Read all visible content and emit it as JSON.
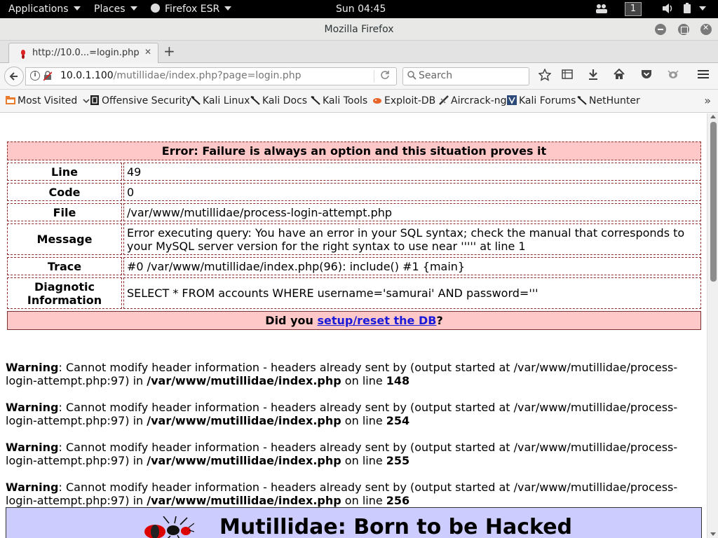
{
  "system_bar": {
    "applications": "Applications",
    "places": "Places",
    "firefox": "Firefox ESR",
    "clock": "Sun 04:45",
    "workspace": "1"
  },
  "window": {
    "title": "Mozilla Firefox"
  },
  "tab": {
    "title": "http://10.0...=login.php",
    "close": "✕",
    "new_tab": "+"
  },
  "navbar": {
    "url_host": "10.0.1.100",
    "url_path": "/mutillidae/index.php?page=login.php",
    "search_placeholder": "Search"
  },
  "bookmarks": {
    "items": [
      {
        "label": "Most Visited",
        "icon": "folder-icon"
      },
      {
        "label": "Offensive Security",
        "icon": "offsec-icon"
      },
      {
        "label": "Kali Linux",
        "icon": "kali-icon"
      },
      {
        "label": "Kali Docs",
        "icon": "kali-icon"
      },
      {
        "label": "Kali Tools",
        "icon": "kali-icon"
      },
      {
        "label": "Exploit-DB",
        "icon": "exploitdb-icon"
      },
      {
        "label": "Aircrack-ng",
        "icon": "aircrack-icon"
      },
      {
        "label": "Kali Forums",
        "icon": "kali-forums-icon"
      },
      {
        "label": "NetHunter",
        "icon": "kali-icon"
      }
    ],
    "more": "»"
  },
  "error_table": {
    "heading": "Error: Failure is always an option and this situation proves it",
    "rows": [
      {
        "label": "Line",
        "value": "49"
      },
      {
        "label": "Code",
        "value": "0"
      },
      {
        "label": "File",
        "value": "/var/www/mutillidae/process-login-attempt.php"
      },
      {
        "label": "Message",
        "value": "Error executing query: You have an error in your SQL syntax; check the manual that corresponds to your MySQL server version for the right syntax to use near ''''' at line 1"
      },
      {
        "label": "Trace",
        "value": "#0 /var/www/mutillidae/index.php(96): include() #1 {main}"
      },
      {
        "label": "Diagnotic Information",
        "value": "SELECT * FROM accounts WHERE username='samurai' AND password='''"
      }
    ],
    "footer_prefix": "Did you ",
    "footer_link": "setup/reset the DB",
    "footer_suffix": "?"
  },
  "warnings": [
    {
      "label": "Warning",
      "text": ": Cannot modify header information - headers already sent by (output started at /var/www/mutillidae/process-login-attempt.php:97) in ",
      "file": "/var/www/mutillidae/index.php",
      "on_line": " on line ",
      "line": "148"
    },
    {
      "label": "Warning",
      "text": ": Cannot modify header information - headers already sent by (output started at /var/www/mutillidae/process-login-attempt.php:97) in ",
      "file": "/var/www/mutillidae/index.php",
      "on_line": " on line ",
      "line": "254"
    },
    {
      "label": "Warning",
      "text": ": Cannot modify header information - headers already sent by (output started at /var/www/mutillidae/process-login-attempt.php:97) in ",
      "file": "/var/www/mutillidae/index.php",
      "on_line": " on line ",
      "line": "255"
    },
    {
      "label": "Warning",
      "text": ": Cannot modify header information - headers already sent by (output started at /var/www/mutillidae/process-login-attempt.php:97) in ",
      "file": "/var/www/mutillidae/index.php",
      "on_line": " on line ",
      "line": "256"
    }
  ],
  "banner": {
    "title": "Mutillidae: Born to be Hacked"
  }
}
